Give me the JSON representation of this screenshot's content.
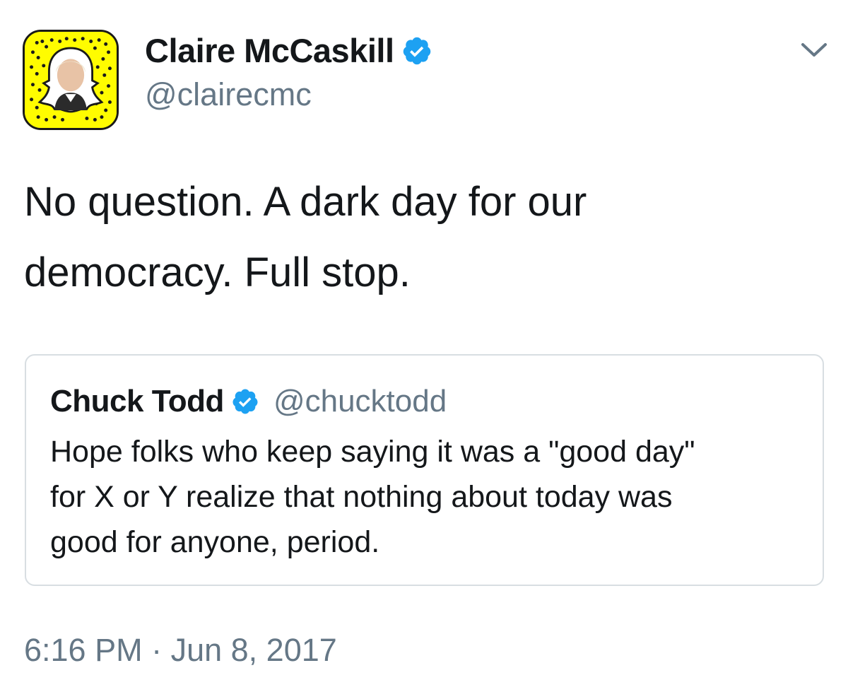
{
  "author": {
    "name": "Claire McCaskill",
    "handle": "@clairecmc",
    "verified": true,
    "avatar_icon": "snapcode-avatar-icon",
    "avatar_color": "#fffc00"
  },
  "tweet": {
    "text_lines": [
      "No question. A dark day for our",
      "democracy. Full stop."
    ],
    "timestamp": "6:16 PM · Jun 8, 2017"
  },
  "quoted_tweet": {
    "name": "Chuck Todd",
    "handle": "@chucktodd",
    "verified": true,
    "text_lines": [
      "Hope folks who keep saying it was a \"good day\"",
      "for X or Y realize that nothing about today was",
      "good for anyone, period."
    ]
  },
  "colors": {
    "text_primary": "#14171a",
    "text_secondary": "#657786",
    "verified_blue": "#1da1f2",
    "border": "#d8dee2"
  },
  "icons": {
    "verified": "verified-badge-icon",
    "menu": "chevron-down-icon"
  }
}
